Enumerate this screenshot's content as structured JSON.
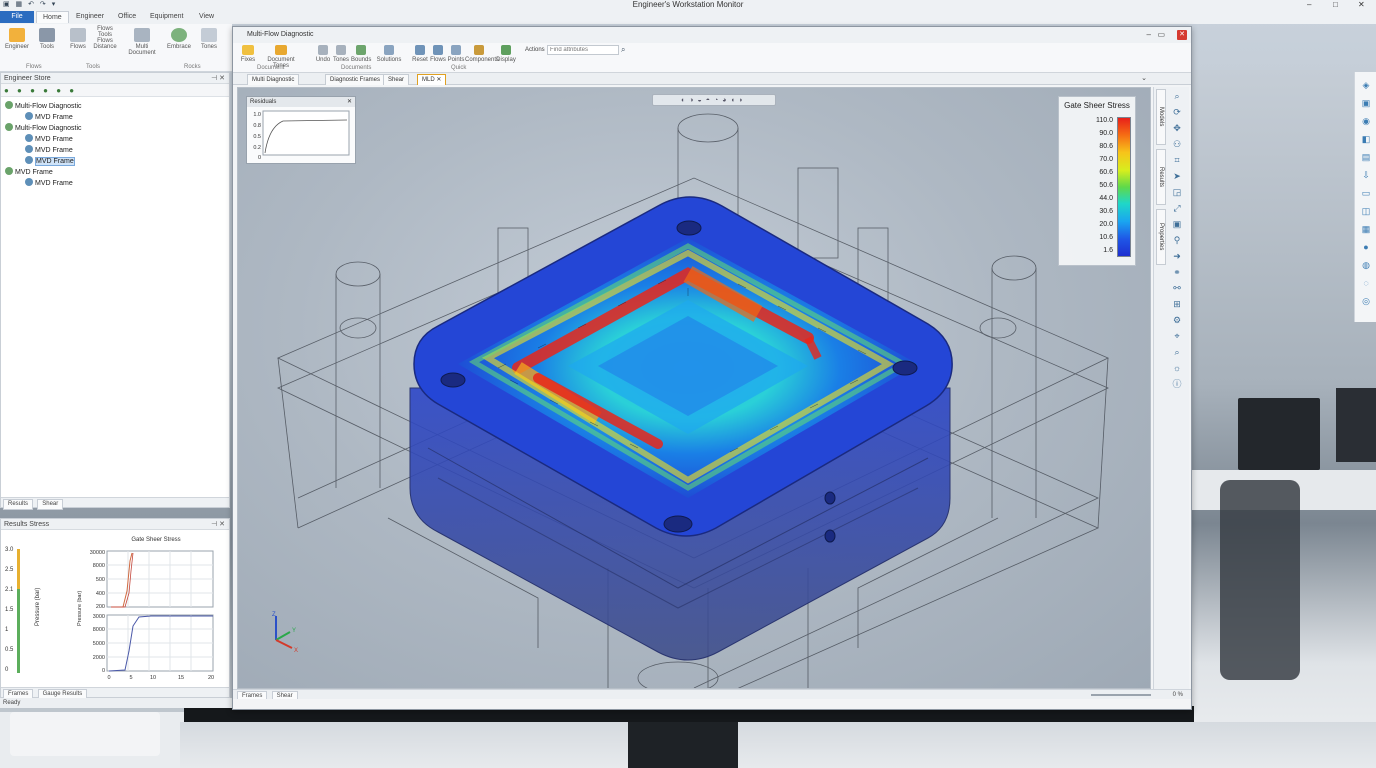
{
  "window": {
    "title": "Engineer's Workstation Monitor",
    "controls": [
      "–",
      "□",
      "✕"
    ],
    "quick_access": "▣ ▦ ↶ ↷ ▾"
  },
  "ribbon": {
    "tabs": [
      "File",
      "Home",
      "Engineer",
      "Office",
      "Equipment",
      "View"
    ],
    "buttons": [
      {
        "label": "Engineer",
        "icon": "folder-icon"
      },
      {
        "label": "Tools",
        "icon": "save-icon"
      },
      {
        "label": "Flows",
        "icon": "edit-icon"
      },
      {
        "label": "Multi Document",
        "icon": "document-icon"
      },
      {
        "label": "Embrace",
        "icon": "globe-icon"
      },
      {
        "label": "Tones",
        "icon": "brush-icon"
      }
    ],
    "groups": [
      "Flows",
      "Tools",
      "Rocks"
    ],
    "button_sublabels": [
      "Flows",
      "Tools",
      "Flows",
      "Distance"
    ]
  },
  "explorer": {
    "title": "Engineer Store",
    "tree": [
      {
        "label": "Multi-Flow Diagnostic",
        "level": 0
      },
      {
        "label": "MVD Frame",
        "level": 1
      },
      {
        "label": "Multi-Flow Diagnostic",
        "level": 0
      },
      {
        "label": "MVD Frame",
        "level": 1
      },
      {
        "label": "MVD Frame",
        "level": 1
      },
      {
        "label": "MVD Frame",
        "level": 1,
        "selected": true
      },
      {
        "label": "MVD Frame",
        "level": 0
      },
      {
        "label": "MVD Frame",
        "level": 1
      }
    ],
    "tabs": [
      "Results",
      "Shear"
    ]
  },
  "results_panel": {
    "title": "Results Stress",
    "chart_title": "Gate Sheer Stress",
    "bottom_tabs": [
      "Frames",
      "Gauge Results"
    ],
    "left_gauge_ticks": [
      "3.0",
      "2.5",
      "2.1",
      "1.5",
      "1",
      "0.5",
      "0"
    ],
    "left_gauge_label": "Pressure (bar)",
    "top_chart_yticks": [
      "30000",
      "8000",
      "500",
      "400",
      "200"
    ],
    "bottom_chart_yticks": [
      "3000",
      "8000",
      "5000",
      "2000",
      "0"
    ],
    "bottom_chart_xticks": [
      "0",
      "5",
      "10",
      "15",
      "20"
    ],
    "y_axis_label": "Pressure (bar)"
  },
  "status": {
    "app_status": "Ready",
    "zoom": "0 %",
    "doc_tabs_bottom": [
      "Frames",
      "Shear"
    ]
  },
  "document": {
    "title": "Multi-Flow Diagnostic",
    "ribbon_buttons": [
      "Fixes",
      "Document Tones",
      "Undo",
      "Tones",
      "Bounds",
      "Solutions",
      "Reset",
      "Flows",
      "Points",
      "Components",
      "Display"
    ],
    "ribbon_groups": [
      "Document",
      "Documents",
      "Quick"
    ],
    "search_label": "Actions",
    "search_placeholder": "Find attributes",
    "tabs": [
      "Multi Diagnostic",
      "Diagnostic Frames",
      "Shear",
      "MLD"
    ]
  },
  "viewport": {
    "toolbar_icons": [
      "◐",
      "◑",
      "◒",
      "◓",
      "◔",
      "◕",
      "◖",
      "◗"
    ],
    "residuals_title": "Residuals",
    "residuals_ticks": [
      "1.0",
      "0.8",
      "0.5",
      "0.2",
      "0"
    ],
    "axis_labels": {
      "x": "X",
      "y": "Y",
      "z": "Z"
    }
  },
  "legend": {
    "title": "Gate Sheer Stress",
    "values": [
      "110.0",
      "90.0",
      "80.6",
      "70.0",
      "60.6",
      "50.6",
      "44.0",
      "30.6",
      "20.0",
      "10.6",
      "1.6"
    ]
  },
  "right_strip": {
    "vertical_tabs": [
      "Models",
      "Results",
      "Properties"
    ]
  }
}
